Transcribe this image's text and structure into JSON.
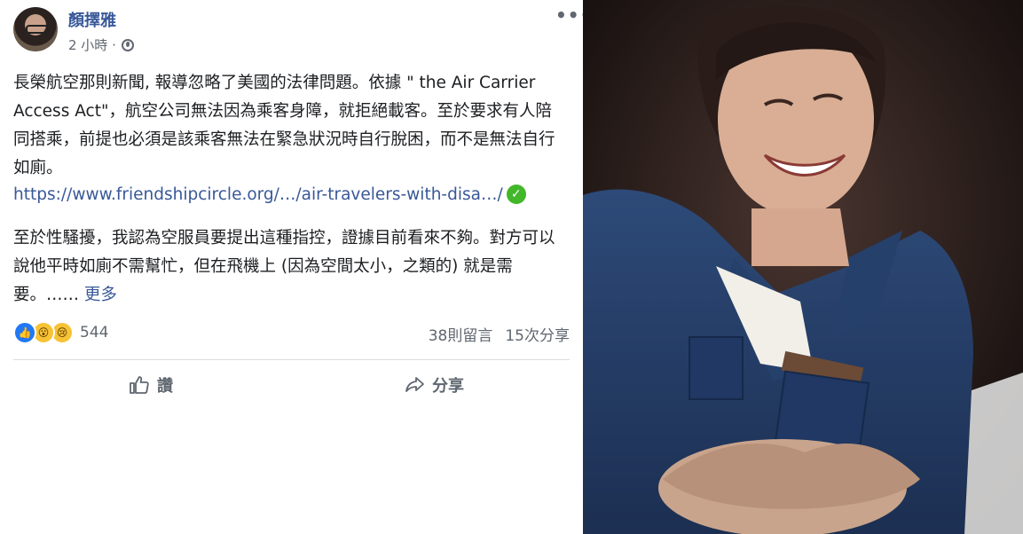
{
  "post": {
    "author": "顏擇雅",
    "time": "2 小時 ·",
    "more_icon": "more-icon",
    "paragraph1": "長榮航空那則新聞, 報導忽略了美國的法律問題。依據 \" the Air Carrier Access Act\"，航空公司無法因為乘客身障，就拒絕載客。至於要求有人陪同搭乘，前提也必須是該乘客無法在緊急狀況時自行脫困，而不是無法自行如廁。",
    "link": "https://www.friendshipcircle.org/…/air-travelers-with-disa…/",
    "paragraph2": "至於性騷擾，我認為空服員要提出這種指控，證據目前看來不夠。對方可以說他平時如廁不需幫忙，但在飛機上 (因為空間太小，之類的) 就是需要。……",
    "see_more": "更多",
    "reaction_count": "544",
    "comments": "38則留言",
    "shares": "15次分享",
    "like_label": "讚",
    "share_label": "分享"
  },
  "colors": {
    "link_blue": "#385898",
    "meta_gray": "#606770",
    "like_blue": "#2078f4",
    "verified_green": "#42b72a"
  }
}
